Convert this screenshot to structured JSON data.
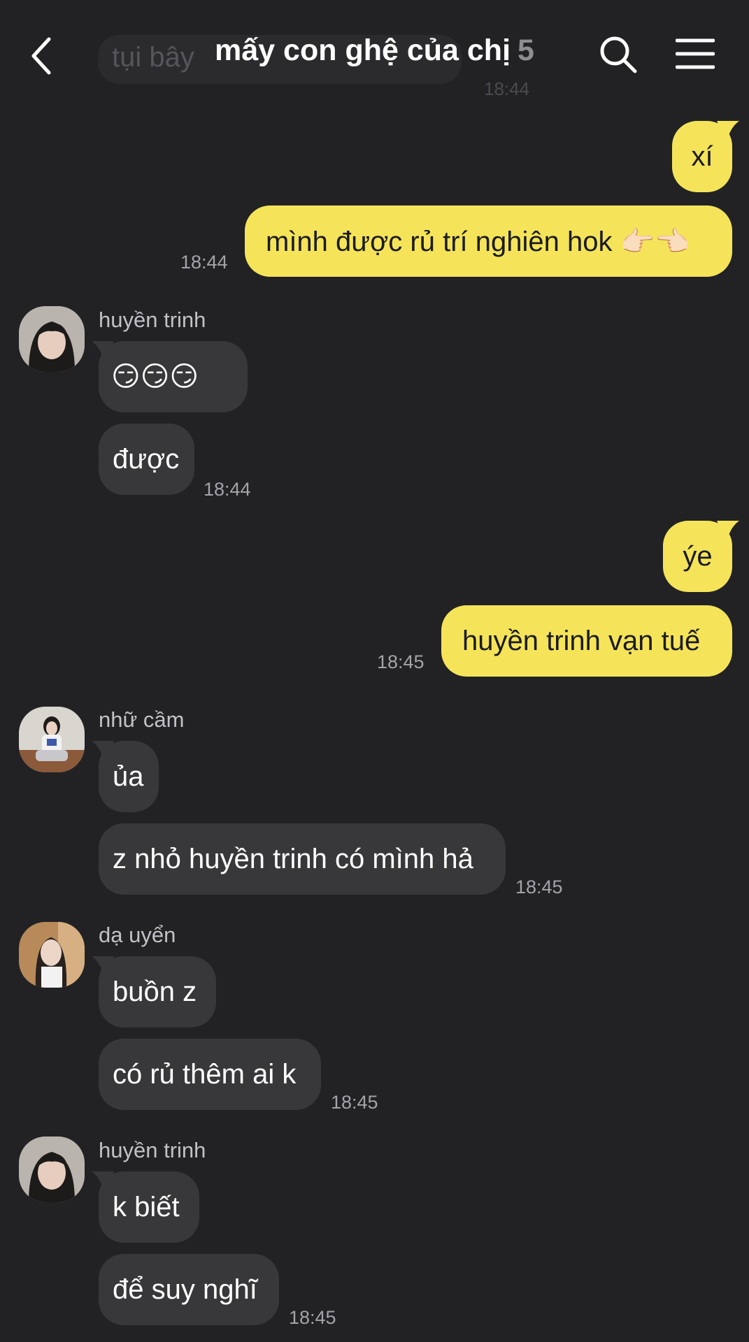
{
  "header": {
    "title": "mấy con ghệ của chị",
    "member_count": "5"
  },
  "ghost": {
    "text": "tụi bây",
    "time": "18:44"
  },
  "messages": {
    "m1": "xí",
    "m2": "mình được rủ trí nghiên hok 👉🏻👈🏻",
    "m2_time": "18:44",
    "g1_sender": "huyền trinh",
    "m3": "😏😏😏",
    "m4": "được",
    "m4_time": "18:44",
    "m5": "ýe",
    "m6": "huyền trinh vạn tuế",
    "m6_time": "18:45",
    "g2_sender": "nhữ cầm",
    "m7": "ủa",
    "m8": "z nhỏ huyền trinh có mình hả",
    "m8_time": "18:45",
    "g3_sender": "dạ uyển",
    "m9": "buồn z",
    "m10": "có rủ thêm ai k",
    "m10_time": "18:45",
    "g4_sender": "huyền trinh",
    "m11": "k biết",
    "m12": "để suy nghĩ",
    "m12_time": "18:45"
  },
  "colors": {
    "background": "#222225",
    "outgoing_bubble": "#f5e45a",
    "incoming_bubble": "#38383b"
  },
  "icons": [
    "back-arrow-icon",
    "search-icon",
    "menu-icon"
  ]
}
